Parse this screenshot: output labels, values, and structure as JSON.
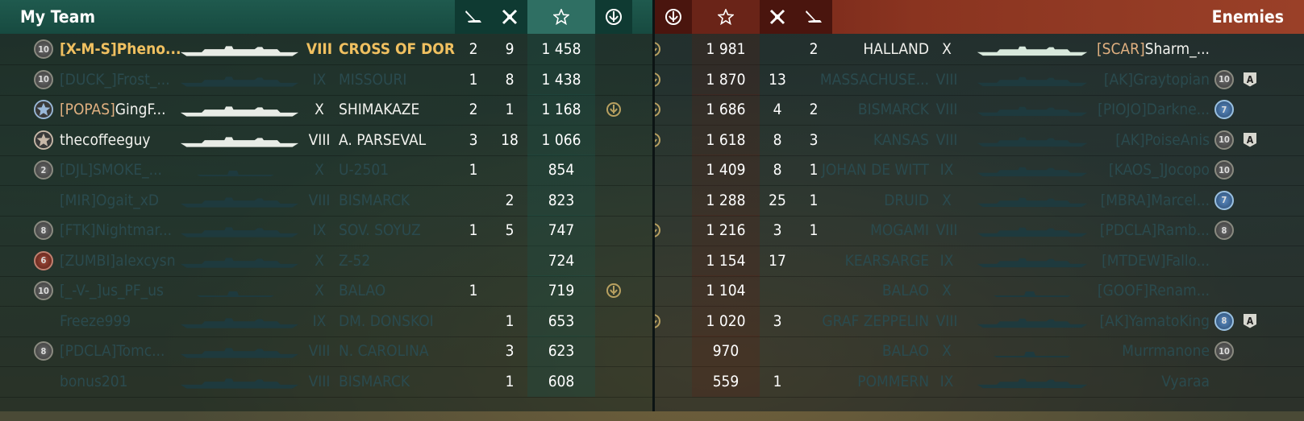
{
  "my_team": {
    "title": "My Team",
    "header_icons": [
      "torpedo-icon",
      "planes-shot-icon",
      "star-xp-icon",
      "achievement-icon"
    ],
    "rows": [
      {
        "rank": "10",
        "clan": "[X-M-S]",
        "player": "Pheno...",
        "tier": "VIII",
        "ship": "CROSS OF DORN",
        "torp": "2",
        "planes": "9",
        "xp": "1 458",
        "medal": false,
        "status": "me"
      },
      {
        "rank": "10",
        "clan": "[DUCK_]",
        "player": "Frost_...",
        "tier": "IX",
        "ship": "MISSOURI",
        "torp": "1",
        "planes": "8",
        "xp": "1 438",
        "medal": false,
        "status": "dead"
      },
      {
        "rank": "star-blue",
        "clan": "[POPAS]",
        "player": "GingF...",
        "tier": "X",
        "ship": "SHIMAKAZE",
        "torp": "2",
        "planes": "1",
        "xp": "1 168",
        "medal": true,
        "status": "alive"
      },
      {
        "rank": "star",
        "clan": "",
        "player": "thecoffeeguy",
        "tier": "VIII",
        "ship": "A. PARSEVAL",
        "torp": "3",
        "planes": "18",
        "xp": "1 066",
        "medal": false,
        "status": "alive"
      },
      {
        "rank": "2",
        "clan": "[DJL]",
        "player": "SMOKE_...",
        "tier": "X",
        "ship": "U-2501",
        "torp": "1",
        "planes": "",
        "xp": "854",
        "medal": false,
        "status": "dead"
      },
      {
        "rank": "",
        "clan": "[MIR]",
        "player": "Ogait_xD",
        "tier": "VIII",
        "ship": "BISMARCK",
        "torp": "",
        "planes": "2",
        "xp": "823",
        "medal": false,
        "status": "dead"
      },
      {
        "rank": "8",
        "clan": "[FTK]",
        "player": "Nightmar...",
        "tier": "IX",
        "ship": "SOV. SOYUZ",
        "torp": "1",
        "planes": "5",
        "xp": "747",
        "medal": false,
        "status": "dead"
      },
      {
        "rank": "6",
        "clan": "[ZUMBI]",
        "player": "alexcysn",
        "tier": "X",
        "ship": "Z-52",
        "torp": "",
        "planes": "",
        "xp": "724",
        "medal": false,
        "status": "dead"
      },
      {
        "rank": "10",
        "clan": "[_-V-_]",
        "player": "us_PF_us",
        "tier": "X",
        "ship": "BALAO",
        "torp": "1",
        "planes": "",
        "xp": "719",
        "medal": true,
        "status": "dead"
      },
      {
        "rank": "",
        "clan": "",
        "player": "Freeze999",
        "tier": "IX",
        "ship": "DM. DONSKOI",
        "torp": "",
        "planes": "1",
        "xp": "653",
        "medal": false,
        "status": "dead"
      },
      {
        "rank": "8",
        "clan": "[PDCLA]",
        "player": "Tomc...",
        "tier": "VIII",
        "ship": "N. CAROLINA",
        "torp": "",
        "planes": "3",
        "xp": "623",
        "medal": false,
        "status": "dead"
      },
      {
        "rank": "",
        "clan": "",
        "player": "bonus201",
        "tier": "VIII",
        "ship": "BISMARCK",
        "torp": "",
        "planes": "1",
        "xp": "608",
        "medal": false,
        "status": "dead"
      }
    ]
  },
  "enemies": {
    "title": "Enemies",
    "header_icons": [
      "achievement-icon",
      "star-xp-icon",
      "planes-shot-icon",
      "torpedo-icon"
    ],
    "rows": [
      {
        "medal": true,
        "xp": "1 981",
        "planes": "",
        "torp": "2",
        "ship": "HALLAND",
        "tier": "X",
        "clan": "[SCAR]",
        "player": "Sharm_...",
        "rank": "",
        "badge": "",
        "status": "alive"
      },
      {
        "medal": true,
        "xp": "1 870",
        "planes": "13",
        "torp": "",
        "ship": "MASSACHUSE...",
        "tier": "VIII",
        "clan": "[AK]",
        "player": "Graytopian",
        "rank": "10",
        "badge": "A",
        "status": "dead"
      },
      {
        "medal": true,
        "xp": "1 686",
        "planes": "4",
        "torp": "2",
        "ship": "BISMARCK",
        "tier": "VIII",
        "clan": "[PIOJO]",
        "player": "Darkne...",
        "rank": "7",
        "badge": "",
        "status": "dead"
      },
      {
        "medal": true,
        "xp": "1 618",
        "planes": "8",
        "torp": "3",
        "ship": "KANSAS",
        "tier": "VIII",
        "clan": "[AK]",
        "player": "PoiseAnis",
        "rank": "10",
        "badge": "A",
        "status": "dead"
      },
      {
        "medal": false,
        "xp": "1 409",
        "planes": "8",
        "torp": "1",
        "ship": "JOHAN DE WITT",
        "tier": "IX",
        "clan": "[KAOS_]",
        "player": "Jocopo",
        "rank": "10",
        "badge": "",
        "status": "dead"
      },
      {
        "medal": false,
        "xp": "1 288",
        "planes": "25",
        "torp": "1",
        "ship": "DRUID",
        "tier": "X",
        "clan": "[MBRA]",
        "player": "Marcel...",
        "rank": "7",
        "badge": "",
        "status": "dead"
      },
      {
        "medal": true,
        "xp": "1 216",
        "planes": "3",
        "torp": "1",
        "ship": "MOGAMI",
        "tier": "VIII",
        "clan": "[PDCLA]",
        "player": "Ramb...",
        "rank": "8",
        "badge": "",
        "status": "dead"
      },
      {
        "medal": false,
        "xp": "1 154",
        "planes": "17",
        "torp": "",
        "ship": "KEARSARGE",
        "tier": "IX",
        "clan": "[MTDEW]",
        "player": "Fallo...",
        "rank": "",
        "badge": "",
        "status": "dead"
      },
      {
        "medal": false,
        "xp": "1 104",
        "planes": "",
        "torp": "",
        "ship": "BALAO",
        "tier": "X",
        "clan": "[GOOF]",
        "player": "Renam...",
        "rank": "",
        "badge": "",
        "status": "dead"
      },
      {
        "medal": true,
        "xp": "1 020",
        "planes": "3",
        "torp": "",
        "ship": "GRAF ZEPPELIN",
        "tier": "VIII",
        "clan": "[AK]",
        "player": "YamatoKing",
        "rank": "8",
        "badge": "A",
        "status": "dead"
      },
      {
        "medal": false,
        "xp": "970",
        "planes": "",
        "torp": "",
        "ship": "BALAO",
        "tier": "X",
        "clan": "",
        "player": "Murrmanone",
        "rank": "10",
        "badge": "",
        "status": "dead"
      },
      {
        "medal": false,
        "xp": "559",
        "planes": "1",
        "torp": "",
        "ship": "POMMERN",
        "tier": "IX",
        "clan": "",
        "player": "Vyaraa",
        "rank": "",
        "badge": "",
        "status": "dead"
      }
    ]
  },
  "colors": {
    "my_header": "#1f5a4e",
    "enemy_header": "#8a3420",
    "highlight": "#f0c060",
    "clan": "#c08a5a"
  }
}
